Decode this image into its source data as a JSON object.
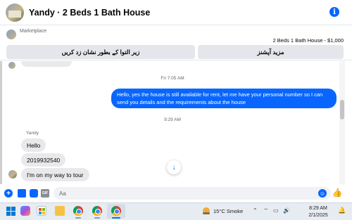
{
  "header": {
    "title": "Yandy · 2 Beds 1 Bath House",
    "info_icon": "i"
  },
  "marketplace": {
    "label": "Marketplace",
    "listing": "2 Beds 1 Bath House - $1,000",
    "buttons": {
      "mark_label": "زیر التوا کے بطور نشان زد کریں",
      "more_options_label": "مزید آپشنز"
    }
  },
  "chat": {
    "timestamps": [
      "Fri 7:05 AM",
      "9:29 AM"
    ],
    "outgoing": [
      "Hello, yes the house is still available for rent, let me have your personal number so I can send you details and the requirements about the house"
    ],
    "sender_name": "Yandy",
    "incoming": [
      "Hello",
      "2019932540",
      "I'm on my way to tour"
    ],
    "scroll_down_icon": "↓"
  },
  "composer": {
    "placeholder": "Aa",
    "plus_icon": "+",
    "gif_label": "GIF",
    "emoji_icon": "☺",
    "like_icon": "👍"
  },
  "taskbar": {
    "weather": "15°C  Smoke",
    "time": "8:29 AM",
    "date": "2/1/2025",
    "tray_up_icon": "⌃",
    "tray_net_icon": "⌔",
    "tray_battery_icon": "▭",
    "tray_volume_icon": "🔊",
    "bell_icon": "🔔"
  },
  "colors": {
    "accent": "#0866ff",
    "bubble_incoming": "#e9e9eb"
  }
}
